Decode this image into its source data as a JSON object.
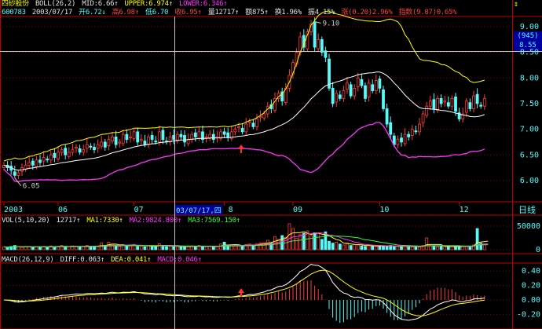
{
  "header": {
    "stock_name": "四砂股份",
    "indicator": "BOLL(26,2)",
    "mid": "MID:6.66↑",
    "upper": "UPPER:6.974↑",
    "lower": "LOWER:6.346↑",
    "code": "600783",
    "date": "2003/07/17",
    "open": "开6.72↓",
    "high": "高6.98↑",
    "low": "低6.70",
    "close": "收6.95↑",
    "volume": "量12717↑",
    "amount": "额875↑",
    "turnover": "换1.96%",
    "amplitude": "振4.15%",
    "change": "涨(0.20)2.96%",
    "index": "指数(9.87)0.65%"
  },
  "volume_header": {
    "name": "VOL(5,10,20)",
    "value": "12717↑",
    "ma1": "MA1:7330↑",
    "ma2": "MA2:9824.800↑",
    "ma3": "MA3:7569.150↑"
  },
  "macd_header": {
    "name": "MACD(26,12,9)",
    "diff": "DIFF:0.063↑",
    "dea": "DEA:0.041↑",
    "macd": "MACD:0.046↑"
  },
  "cursor": {
    "date_label": "03/07/17,四",
    "price_box_top": "(945)",
    "price_box_value": "8.55"
  },
  "period_label": "日线",
  "colors": {
    "up": "#ff3c3c",
    "down": "#54fcfc",
    "background": "#000000",
    "grid": "#a00000",
    "mid": "#ffffff",
    "upper": "#ffff00",
    "lower": "#ff33ff"
  },
  "icons": {
    "scroll": "arrow-up-down-icon",
    "marker": "red-up-arrow-icon"
  },
  "chart_data": [
    {
      "type": "candlestick",
      "title": "",
      "y_ticks": [
        "9.00",
        "8.50",
        "8.00",
        "7.50",
        "7.00",
        "6.50",
        "6.00"
      ],
      "ylim": [
        5.8,
        9.3
      ],
      "x_tick_labels": [
        {
          "label": "2003",
          "index": 0
        },
        {
          "label": "06",
          "index": 15
        },
        {
          "label": "07",
          "index": 36
        },
        {
          "label": "08",
          "index": 61
        },
        {
          "label": "09",
          "index": 80
        },
        {
          "label": "10",
          "index": 104
        },
        {
          "label": "12",
          "index": 126
        }
      ],
      "annotations": [
        {
          "text": "6.05",
          "index": 3
        },
        {
          "text": "9.10",
          "index": 86
        }
      ],
      "close": [
        6.3,
        6.25,
        6.2,
        6.1,
        6.15,
        6.25,
        6.3,
        6.35,
        6.3,
        6.4,
        6.35,
        6.45,
        6.4,
        6.5,
        6.45,
        6.55,
        6.6,
        6.5,
        6.55,
        6.6,
        6.65,
        6.55,
        6.6,
        6.7,
        6.65,
        6.6,
        6.7,
        6.75,
        6.65,
        6.8,
        6.85,
        6.7,
        6.75,
        6.9,
        6.8,
        6.85,
        6.95,
        6.75,
        6.8,
        6.7,
        6.85,
        6.8,
        6.75,
        6.95,
        6.8,
        6.75,
        6.85,
        6.8,
        6.9,
        6.85,
        6.75,
        6.8,
        6.9,
        6.85,
        6.95,
        6.8,
        6.85,
        6.9,
        6.8,
        6.85,
        6.95,
        6.9,
        6.85,
        6.95,
        7.0,
        7.05,
        6.95,
        7.1,
        7.15,
        7.05,
        7.2,
        7.25,
        7.3,
        7.45,
        7.4,
        7.6,
        7.7,
        7.55,
        7.8,
        8.05,
        8.3,
        8.5,
        8.8,
        8.6,
        8.9,
        9.05,
        8.6,
        8.75,
        8.5,
        8.4,
        7.8,
        7.5,
        7.7,
        7.6,
        7.75,
        7.9,
        7.65,
        7.8,
        8.0,
        7.85,
        7.6,
        7.9,
        7.75,
        7.95,
        7.8,
        7.4,
        7.1,
        6.9,
        6.7,
        6.8,
        6.75,
        6.9,
        6.85,
        7.0,
        6.95,
        7.1,
        7.3,
        7.45,
        7.55,
        7.4,
        7.6,
        7.5,
        7.55,
        7.45,
        7.6,
        7.35,
        7.2,
        7.3,
        7.55,
        7.4,
        7.65,
        7.5,
        7.45,
        7.6
      ],
      "bollinger": {
        "period": 26,
        "width": 2
      }
    },
    {
      "type": "bar",
      "title": "VOL(5,10,20)",
      "y_ticks": [
        "50000",
        "0"
      ],
      "ylim": [
        0,
        55000
      ],
      "volume": [
        6000,
        5000,
        7000,
        9000,
        6000,
        5000,
        6000,
        7000,
        5000,
        6000,
        5500,
        7000,
        6000,
        8000,
        6000,
        7000,
        9000,
        6000,
        6500,
        8000,
        7000,
        6000,
        7500,
        9000,
        7000,
        6000,
        8000,
        14000,
        9000,
        16000,
        12000,
        8000,
        7000,
        10000,
        8000,
        9000,
        11000,
        7000,
        8000,
        6000,
        9000,
        7000,
        6000,
        12717,
        8000,
        6000,
        7000,
        6000,
        8000,
        7000,
        6000,
        6500,
        8000,
        7000,
        9000,
        6000,
        7000,
        8000,
        6000,
        7000,
        12000,
        16000,
        9000,
        8000,
        9000,
        10000,
        7000,
        11000,
        12000,
        8000,
        13000,
        14000,
        15000,
        20000,
        14000,
        28000,
        22000,
        30000,
        26000,
        55000,
        45000,
        24000,
        32000,
        35000,
        40000,
        30000,
        36000,
        35000,
        22000,
        38000,
        18000,
        14000,
        16000,
        12000,
        10000,
        14000,
        9000,
        11000,
        10000,
        8000,
        7000,
        9000,
        8000,
        7000,
        9000,
        8000,
        7000,
        9000,
        6000,
        7000,
        6000,
        8000,
        7000,
        6000,
        7000,
        6000,
        9000,
        25000,
        8000,
        7000,
        6000,
        8000,
        7000,
        6000,
        7000,
        6000,
        7000,
        8000,
        7000,
        6000,
        10000,
        45000,
        14000,
        12000,
        10000
      ]
    },
    {
      "type": "bar+line",
      "title": "MACD(26,12,9)",
      "y_ticks": [
        "0.40",
        "0.20",
        "0.00",
        "-0.20"
      ],
      "ylim": [
        -0.28,
        0.48
      ]
    }
  ]
}
